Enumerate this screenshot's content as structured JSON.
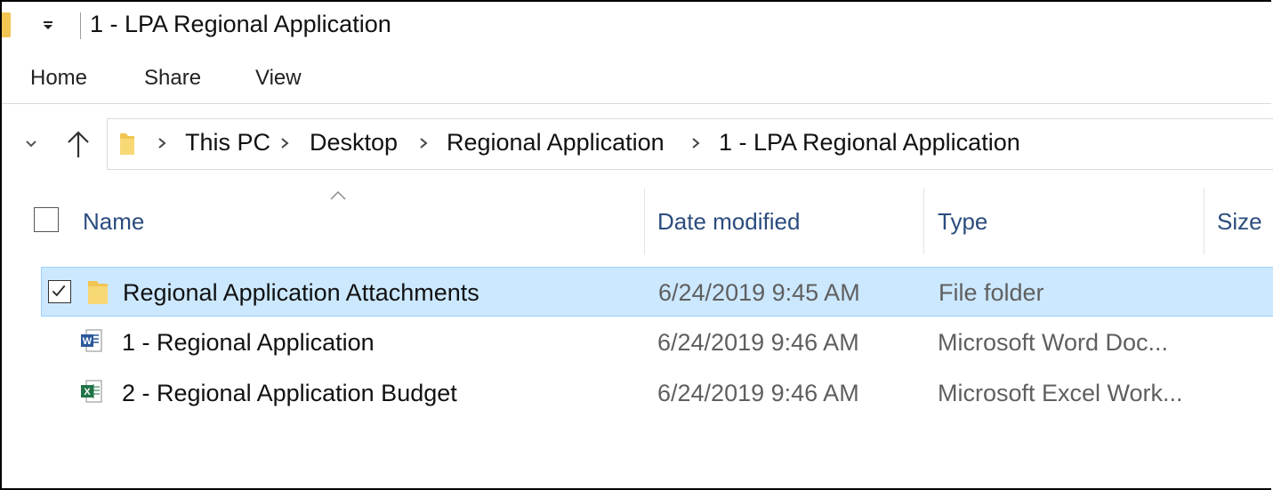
{
  "window": {
    "title": "1 - LPA Regional Application"
  },
  "ribbon": {
    "tabs": [
      {
        "label": "Home"
      },
      {
        "label": "Share"
      },
      {
        "label": "View"
      }
    ]
  },
  "address": {
    "crumbs": [
      {
        "label": "This PC"
      },
      {
        "label": "Desktop"
      },
      {
        "label": "Regional Application"
      },
      {
        "label": "1 - LPA Regional Application"
      }
    ]
  },
  "columns": {
    "name": "Name",
    "date": "Date modified",
    "type": "Type",
    "size": "Size",
    "sorted_by": "Name"
  },
  "files": [
    {
      "icon": "folder-icon",
      "name": "Regional Application Attachments",
      "date": "6/24/2019 9:45 AM",
      "type": "File folder",
      "selected": true
    },
    {
      "icon": "word-document-icon",
      "name": "1 - Regional Application",
      "date": "6/24/2019 9:46 AM",
      "type": "Microsoft Word Doc...",
      "selected": false
    },
    {
      "icon": "excel-workbook-icon",
      "name": "2 - Regional Application Budget",
      "date": "6/24/2019 9:46 AM",
      "type": "Microsoft Excel Work...",
      "selected": false
    }
  ],
  "colors": {
    "selection_bg": "#cce8ff",
    "selection_border": "#99d1ff",
    "folder_yellow": "#f2c552",
    "word_blue": "#2b579a",
    "excel_green": "#217346",
    "header_text": "#2b4c7e"
  }
}
